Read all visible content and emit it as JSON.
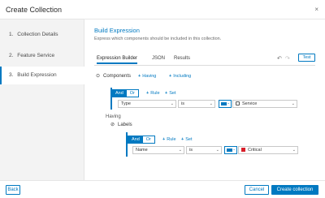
{
  "dialog": {
    "title": "Create Collection",
    "close_glyph": "×"
  },
  "steps": [
    {
      "num": "1.",
      "label": "Collection Details"
    },
    {
      "num": "2.",
      "label": "Feature Service"
    },
    {
      "num": "3.",
      "label": "Build Expression"
    }
  ],
  "section": {
    "title": "Build Expression",
    "description": "Express which components should be included in this collection."
  },
  "tabs": [
    "Expression Builder",
    "JSON",
    "Results"
  ],
  "toolbar": {
    "undo_glyph": "↶",
    "redo_glyph": "↷",
    "test_label": "Test"
  },
  "components": {
    "icon_glyph": "⊙",
    "label": "Components",
    "having_link": "Having",
    "including_link": "Including",
    "and_label": "And",
    "or_label": "Or",
    "rule_link": "Rule",
    "set_link": "Set",
    "field": "Type",
    "operator": "is",
    "value": "Service"
  },
  "having": {
    "label": "Having",
    "labels_icon_glyph": "⊘",
    "labels_label": "Labels",
    "and_label": "And",
    "or_label": "Or",
    "rule_link": "Rule",
    "set_link": "Set",
    "field": "Name",
    "operator": "is",
    "value": "Critical"
  },
  "footer": {
    "back_label": "Back",
    "cancel_label": "Cancel",
    "create_label": "Create collection"
  },
  "colors": {
    "accent": "#0079c1",
    "critical": "#d81f2a"
  }
}
